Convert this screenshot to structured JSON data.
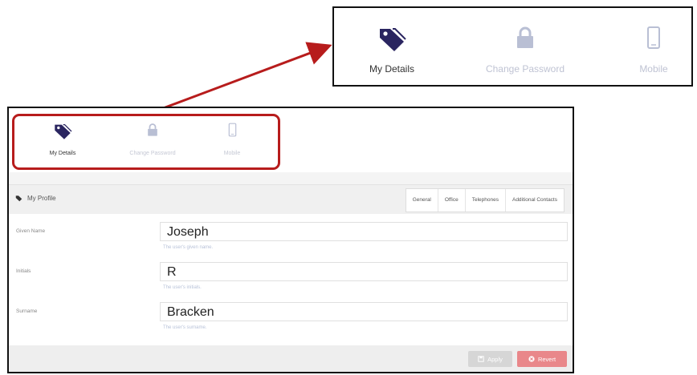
{
  "callout": {
    "tabs": [
      {
        "label": "My Details",
        "icon": "tag-icon",
        "active": true
      },
      {
        "label": "Change Password",
        "icon": "lock-icon",
        "active": false
      },
      {
        "label": "Mobile",
        "icon": "mobile-icon",
        "active": false
      }
    ]
  },
  "nav": {
    "tabs": [
      {
        "label": "My Details",
        "icon": "tag-icon",
        "active": true
      },
      {
        "label": "Change Password",
        "icon": "lock-icon",
        "active": false
      },
      {
        "label": "Mobile",
        "icon": "mobile-icon",
        "active": false
      }
    ]
  },
  "panel": {
    "title": "My Profile",
    "tabs": [
      "General",
      "Office",
      "Telephones",
      "Additional Contacts"
    ],
    "fields": [
      {
        "label": "Given Name",
        "value": "Joseph",
        "hint": "The user's given name."
      },
      {
        "label": "Initials",
        "value": "R",
        "hint": "The user's initials."
      },
      {
        "label": "Surname",
        "value": "Bracken",
        "hint": "The user's surname."
      }
    ],
    "apply_label": "Apply",
    "revert_label": "Revert"
  },
  "colors": {
    "active_icon": "#2a2560",
    "inactive_icon": "#b9bfd4",
    "highlight": "#b71c1c",
    "revert_button": "#e9878a",
    "apply_button": "#d6d6d6"
  }
}
